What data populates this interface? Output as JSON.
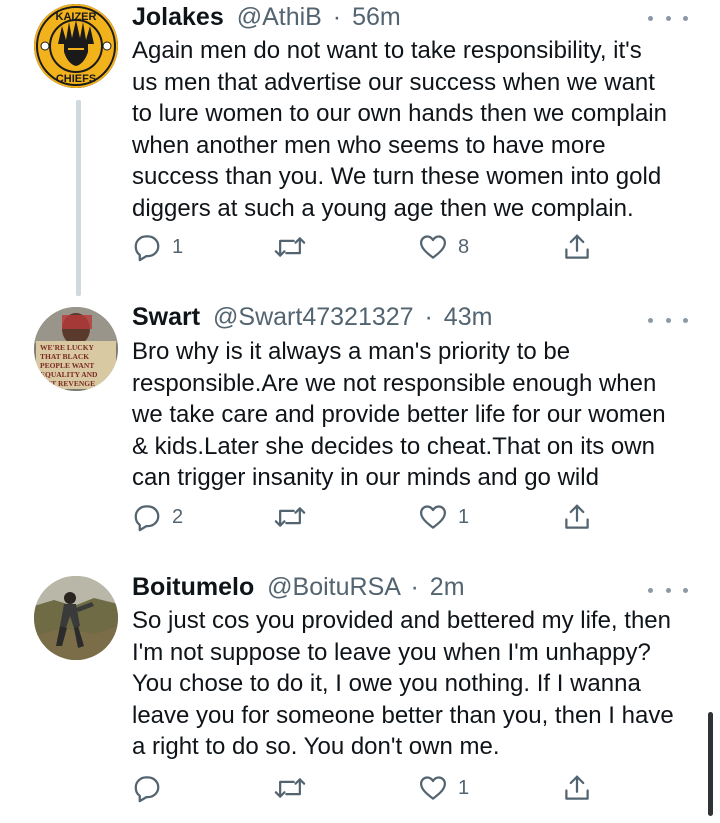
{
  "tweets": [
    {
      "name": "Jolakes",
      "handle": "@AthiB",
      "separator": "·",
      "time": "56m",
      "avatar_icon": "kaizer-chiefs-logo",
      "avatar_text_top": "KAIZER",
      "avatar_text_bottom": "CHIEFS",
      "lines": [
        "Again men do not want to take responsibility, it's",
        "us men that advertise our success when we want",
        "to lure women to our own hands then we complain",
        "when another men who seems to have more",
        "success than you. We turn these women into gold",
        "diggers at such a young age then we complain."
      ],
      "reply_count": "1",
      "retweet_count": "",
      "like_count": "8"
    },
    {
      "name": "Swart",
      "handle": "@Swart47321327",
      "separator": "·",
      "time": "43m",
      "avatar_icon": "protest-sign-photo",
      "avatar_sign_lines": [
        "WE'RE LUCKY",
        "THAT BLACK",
        "PEOPLE WANT",
        "EQUALITY AND",
        "NOT REVENGE"
      ],
      "lines": [
        "Bro why is it always a man's priority to be",
        "responsible.Are we not responsible enough when",
        "we take care and provide better life for our women",
        "& kids.Later she decides to cheat.That on its own",
        "can trigger insanity in our minds and go wild"
      ],
      "reply_count": "2",
      "retweet_count": "",
      "like_count": "1"
    },
    {
      "name": "Boitumelo",
      "handle": "@BoituRSA",
      "separator": "·",
      "time": "2m",
      "avatar_icon": "person-outdoors-photo",
      "lines": [
        "So just cos you provided and bettered my life, then",
        "I'm not suppose to leave you when I'm unhappy?",
        "You chose to do it, I owe you nothing. If I wanna",
        "leave you for someone better than you, then I have",
        "a right to do so. You don't own me."
      ],
      "reply_count": "",
      "retweet_count": "",
      "like_count": "1"
    }
  ],
  "colors": {
    "text": "#0f1419",
    "secondary": "#536471",
    "thread_line": "#cfd9de",
    "icon": "#536471",
    "chiefs_gold": "#f2b21b"
  }
}
